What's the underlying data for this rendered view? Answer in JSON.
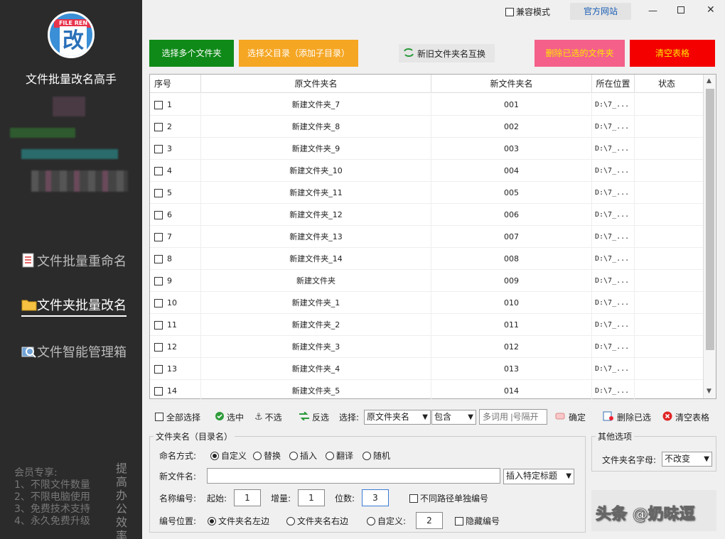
{
  "sidebar": {
    "logo_ribbon": "FILE REN",
    "logo_char": "改",
    "app_title": "文件批量改名高手",
    "nav": [
      {
        "label": "文件批量重命名"
      },
      {
        "label": "文件夹批量改名"
      },
      {
        "label": "文件智能管理箱"
      }
    ],
    "promo": [
      "会员专享:",
      "1、不限文件数量",
      "2、不限电脑使用",
      "3、免费技术支持",
      "4、永久免费升级"
    ],
    "promo_vertical": "提高办公效率"
  },
  "titlebar": {
    "compat_label": "兼容模式",
    "official_label": "官方网站"
  },
  "toolbar": {
    "select_multi": "选择多个文件夹",
    "select_parent": "选择父目录（添加子目录）",
    "swap": "新旧文件夹名互换",
    "delete_selected": "删除已选的文件夹",
    "clear_table": "清空表格"
  },
  "colors": {
    "green": "#0f8a18",
    "orange": "#f5a623",
    "pink": "#f4608a",
    "red": "#f40000"
  },
  "table": {
    "headers": [
      "序号",
      "原文件夹名",
      "新文件夹名",
      "所在位置",
      "状态"
    ],
    "rows": [
      {
        "idx": "1",
        "old": "新建文件夹_7",
        "new": "001",
        "loc": "D:\\7_...",
        "status": ""
      },
      {
        "idx": "2",
        "old": "新建文件夹_8",
        "new": "002",
        "loc": "D:\\7_...",
        "status": ""
      },
      {
        "idx": "3",
        "old": "新建文件夹_9",
        "new": "003",
        "loc": "D:\\7_...",
        "status": ""
      },
      {
        "idx": "4",
        "old": "新建文件夹_10",
        "new": "004",
        "loc": "D:\\7_...",
        "status": ""
      },
      {
        "idx": "5",
        "old": "新建文件夹_11",
        "new": "005",
        "loc": "D:\\7_...",
        "status": ""
      },
      {
        "idx": "6",
        "old": "新建文件夹_12",
        "new": "006",
        "loc": "D:\\7_...",
        "status": ""
      },
      {
        "idx": "7",
        "old": "新建文件夹_13",
        "new": "007",
        "loc": "D:\\7_...",
        "status": ""
      },
      {
        "idx": "8",
        "old": "新建文件夹_14",
        "new": "008",
        "loc": "D:\\7_...",
        "status": ""
      },
      {
        "idx": "9",
        "old": "新建文件夹",
        "new": "009",
        "loc": "D:\\7_...",
        "status": ""
      },
      {
        "idx": "10",
        "old": "新建文件夹_1",
        "new": "010",
        "loc": "D:\\7_...",
        "status": ""
      },
      {
        "idx": "11",
        "old": "新建文件夹_2",
        "new": "011",
        "loc": "D:\\7_...",
        "status": ""
      },
      {
        "idx": "12",
        "old": "新建文件夹_3",
        "new": "012",
        "loc": "D:\\7_...",
        "status": ""
      },
      {
        "idx": "13",
        "old": "新建文件夹_4",
        "new": "013",
        "loc": "D:\\7_...",
        "status": ""
      },
      {
        "idx": "14",
        "old": "新建文件夹_5",
        "new": "014",
        "loc": "D:\\7_...",
        "status": ""
      }
    ]
  },
  "actions": {
    "select_all": "全部选择",
    "check": "选中",
    "uncheck": "不选",
    "invert": "反选",
    "choose_label": "选择:",
    "field_select": "原文件夹名",
    "match_select": "包含",
    "keyword_placeholder": "多词用 |号隔开",
    "confirm": "确定",
    "delete_selected": "删除已选",
    "clear_table": "清空表格"
  },
  "options": {
    "group_title": "文件夹名（目录名）",
    "naming_mode_label": "命名方式:",
    "modes": [
      "自定义",
      "替换",
      "插入",
      "翻译",
      "随机"
    ],
    "new_name_label": "新文件名:",
    "new_name_value": "",
    "insert_title_select": "插入特定标题",
    "numbering_label": "名称编号:",
    "start_label": "起始:",
    "start_value": "1",
    "step_label": "增量:",
    "step_value": "1",
    "digits_label": "位数:",
    "digits_value": "3",
    "separate_path_label": "不同路径单独编号",
    "position_label": "编号位置:",
    "pos_left": "文件夹名左边",
    "pos_right": "文件夹名右边",
    "pos_custom": "自定义:",
    "pos_custom_value": "2",
    "hide_number_label": "隐藏编号"
  },
  "other": {
    "group_title": "其他选项",
    "case_label": "文件夹名字母:",
    "case_select": "不改变"
  },
  "watermark": "头条 @奶味逗"
}
